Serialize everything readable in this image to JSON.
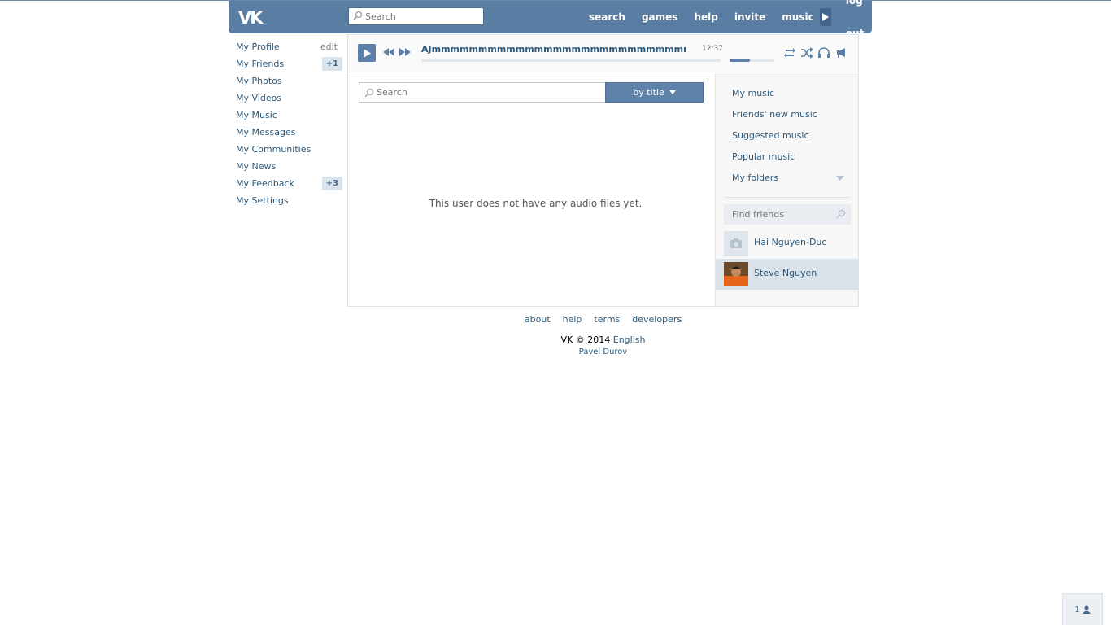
{
  "header": {
    "search_placeholder": "Search",
    "nav": [
      "search",
      "games",
      "help",
      "invite",
      "music"
    ],
    "logout": "log out"
  },
  "leftmenu": {
    "items": [
      {
        "label": "My Profile",
        "right": "edit"
      },
      {
        "label": "My Friends",
        "badge": "+1"
      },
      {
        "label": "My Photos"
      },
      {
        "label": "My Videos"
      },
      {
        "label": "My Music"
      },
      {
        "label": "My Messages"
      },
      {
        "label": "My Communities"
      },
      {
        "label": "My News"
      },
      {
        "label": "My Feedback",
        "badge": "+3"
      },
      {
        "label": "My Settings"
      }
    ]
  },
  "player": {
    "title": "AJmmmmmmmmmmmmmmmmmmmmmmmmmmmmmm...",
    "time": "12:37",
    "progress": 0,
    "volume": 0.45
  },
  "audio": {
    "search_placeholder": "Search",
    "sort_button": "by title",
    "empty_message": "This user does not have any audio files yet."
  },
  "sidebar": {
    "links": [
      "My music",
      "Friends' new music",
      "Suggested music",
      "Popular music",
      "My folders"
    ],
    "find_placeholder": "Find friends",
    "friends": [
      {
        "name": "Hai Nguyen-Duc",
        "active": false
      },
      {
        "name": "Steve Nguyen",
        "active": true
      }
    ]
  },
  "footer": {
    "links": [
      "about",
      "help",
      "terms",
      "developers"
    ],
    "copyright": "VK © 2014",
    "language": "English",
    "author": "Pavel Durov"
  },
  "online_count": "1",
  "colors": {
    "header": "#597da3",
    "link": "#2b587a",
    "badge_bg": "#dae2ea",
    "button": "#5e82a8"
  }
}
